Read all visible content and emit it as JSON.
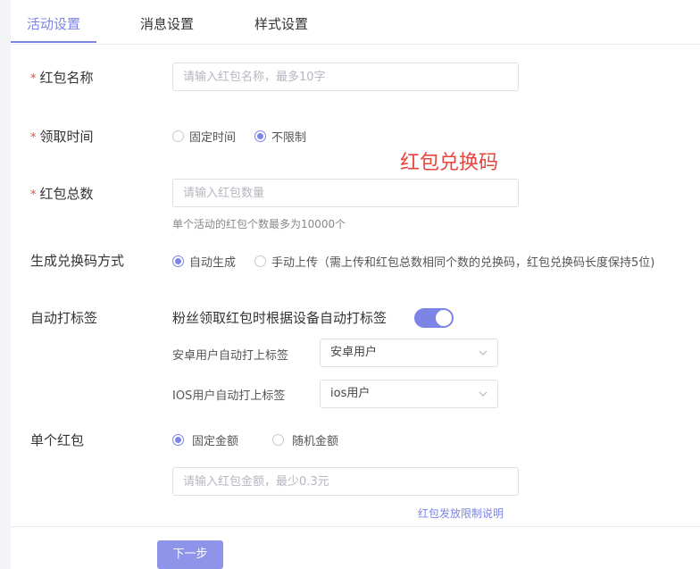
{
  "tabs": [
    {
      "label": "活动设置"
    },
    {
      "label": "消息设置"
    },
    {
      "label": "样式设置"
    }
  ],
  "form": {
    "name": {
      "label": "红包名称",
      "placeholder": "请输入红包名称，最多10字"
    },
    "time": {
      "label": "领取时间",
      "options": [
        "固定时间",
        "不限制"
      ],
      "selected": "不限制"
    },
    "annotation": "红包兑换码",
    "total": {
      "label": "红包总数",
      "placeholder": "请输入红包数量",
      "hint": "单个活动的红包个数最多为10000个"
    },
    "code": {
      "label": "生成兑换码方式",
      "options": [
        "自动生成",
        "手动上传（需上传和红包总数相同个数的兑换码，红包兑换码长度保持5位)"
      ],
      "selected": "自动生成"
    },
    "tag": {
      "label": "自动打标签",
      "toggle_text": "粉丝领取红包时根据设备自动打标签",
      "toggle_on": true,
      "android": {
        "label": "安卓用户自动打上标签",
        "value": "安卓用户"
      },
      "ios": {
        "label": "IOS用户自动打上标签",
        "value": "ios用户"
      }
    },
    "single": {
      "label": "单个红包",
      "options": [
        "固定金额",
        "随机金额"
      ],
      "selected": "固定金额",
      "placeholder": "请输入红包金额，最少0.3元",
      "link": "红包发放限制说明"
    }
  },
  "footer": {
    "next_label": "下一步"
  },
  "colors": {
    "accent": "#7c84e6",
    "required": "#e84a3c",
    "annotation": "#e8443a"
  }
}
